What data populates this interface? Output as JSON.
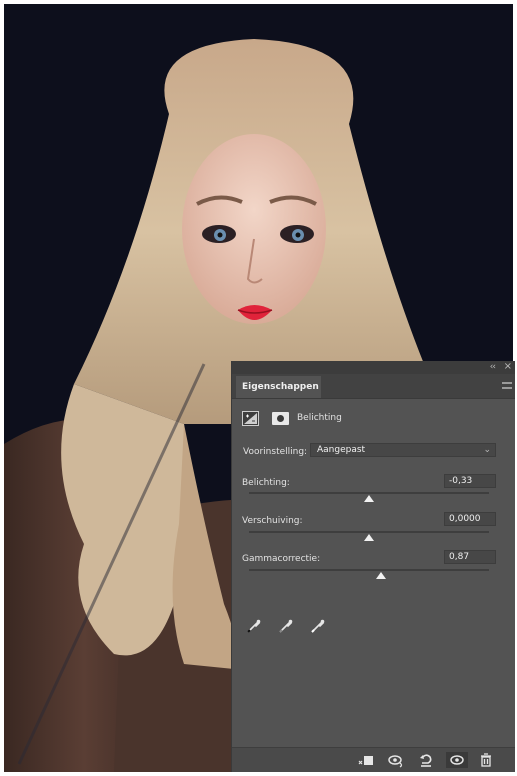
{
  "panel": {
    "tab_label": "Eigenschappen",
    "adjustment_title": "Belichting",
    "preset": {
      "label": "Voorinstelling:",
      "value": "Aangepast"
    },
    "sliders": [
      {
        "label": "Belichting:",
        "value": "-0,33",
        "position": 0.5
      },
      {
        "label": "Verschuiving:",
        "value": "0,0000",
        "position": 0.5
      },
      {
        "label": "Gammacorrectie:",
        "value": "0,87",
        "position": 0.55
      }
    ],
    "eyedroppers": [
      "eyedropper-black-icon",
      "eyedropper-gray-icon",
      "eyedropper-white-icon"
    ],
    "bottom_icons": [
      "clip-to-layer-icon",
      "view-previous-icon",
      "reset-icon",
      "visibility-eye-icon",
      "trash-icon"
    ]
  },
  "colors": {
    "panel_bg": "#535353",
    "photo_bg": "#0d0f1c",
    "text": "#e2e2e2"
  }
}
